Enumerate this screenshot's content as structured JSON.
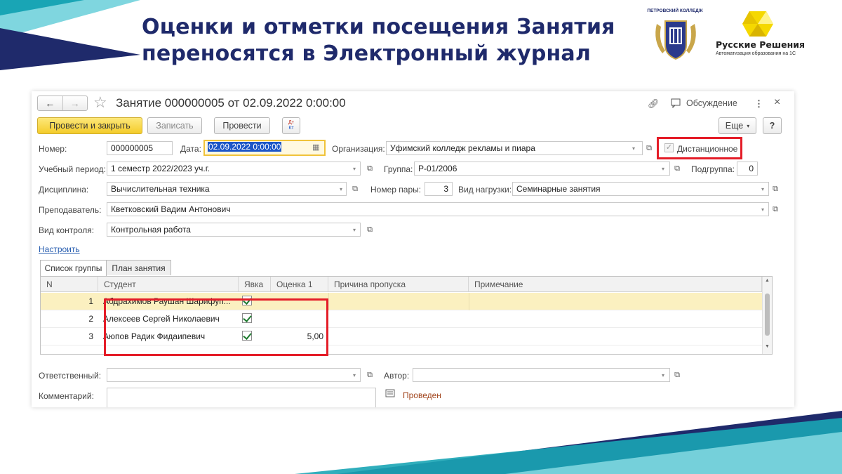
{
  "slide": {
    "title_line1": "Оценки и отметки посещения Занятия",
    "title_line2": "переносятся в Электронный журнал",
    "logo_college": "ПЕТРОВСКИЙ КОЛЛЕДЖ",
    "logo_brand": "Русские Решения",
    "logo_tagline": "Автоматизация образования на 1С",
    "colors": {
      "title": "#1f2a6b",
      "teal": "#19a5b5",
      "navy": "#1f2a6b",
      "highlight": "#e41d28"
    }
  },
  "form": {
    "title": "Занятие 000000005 от 02.09.2022 0:00:00",
    "nav_back": "←",
    "nav_forward": "→",
    "discussion_label": "Обсуждение",
    "more_icon": "⋮",
    "close_icon": "×",
    "toolbar": {
      "post_close": "Провести и закрыть",
      "write": "Записать",
      "post": "Провести",
      "dt_kt_top": "Дт",
      "dt_kt_bottom": "Кт",
      "more": "Еще",
      "help": "?"
    },
    "fields": {
      "number_label": "Номер:",
      "number_value": "000000005",
      "date_label": "Дата:",
      "date_value": "02.09.2022  0:00:00",
      "org_label": "Организация:",
      "org_value": "Уфимский колледж рекламы и пиара",
      "distance_label": "Дистанционное",
      "period_label": "Учебный период:",
      "period_value": "1 семестр 2022/2023 уч.г.",
      "group_label": "Группа:",
      "group_value": "Р-01/2006",
      "subgroup_label": "Подгруппа:",
      "subgroup_value": "0",
      "discipline_label": "Дисциплина:",
      "discipline_value": "Вычислительная техника",
      "pair_label": "Номер пары:",
      "pair_value": "3",
      "load_label": "Вид нагрузки:",
      "load_value": "Семинарные занятия",
      "teacher_label": "Преподаватель:",
      "teacher_value": "Кветковский Вадим Антонович",
      "control_label": "Вид контроля:",
      "control_value": "Контрольная работа",
      "settings_link": "Настроить",
      "responsible_label": "Ответственный:",
      "responsible_value": "",
      "author_label": "Автор:",
      "author_value": "",
      "comment_label": "Комментарий:",
      "comment_value": "",
      "status": "Проведен"
    },
    "tabs": [
      {
        "label": "Список группы"
      },
      {
        "label": "План занятия"
      }
    ],
    "table": {
      "columns": [
        "N",
        "Студент",
        "Явка",
        "Оценка 1",
        "Причина пропуска",
        "Примечание"
      ],
      "rows": [
        {
          "n": "1",
          "student": "Абдрахимов Раушан Шарифуп...",
          "grade": ""
        },
        {
          "n": "2",
          "student": "Алексеев Сергей Николаевич",
          "grade": ""
        },
        {
          "n": "3",
          "student": "Аюпов Радик Фидаипевич",
          "grade": "5,00"
        }
      ]
    }
  }
}
